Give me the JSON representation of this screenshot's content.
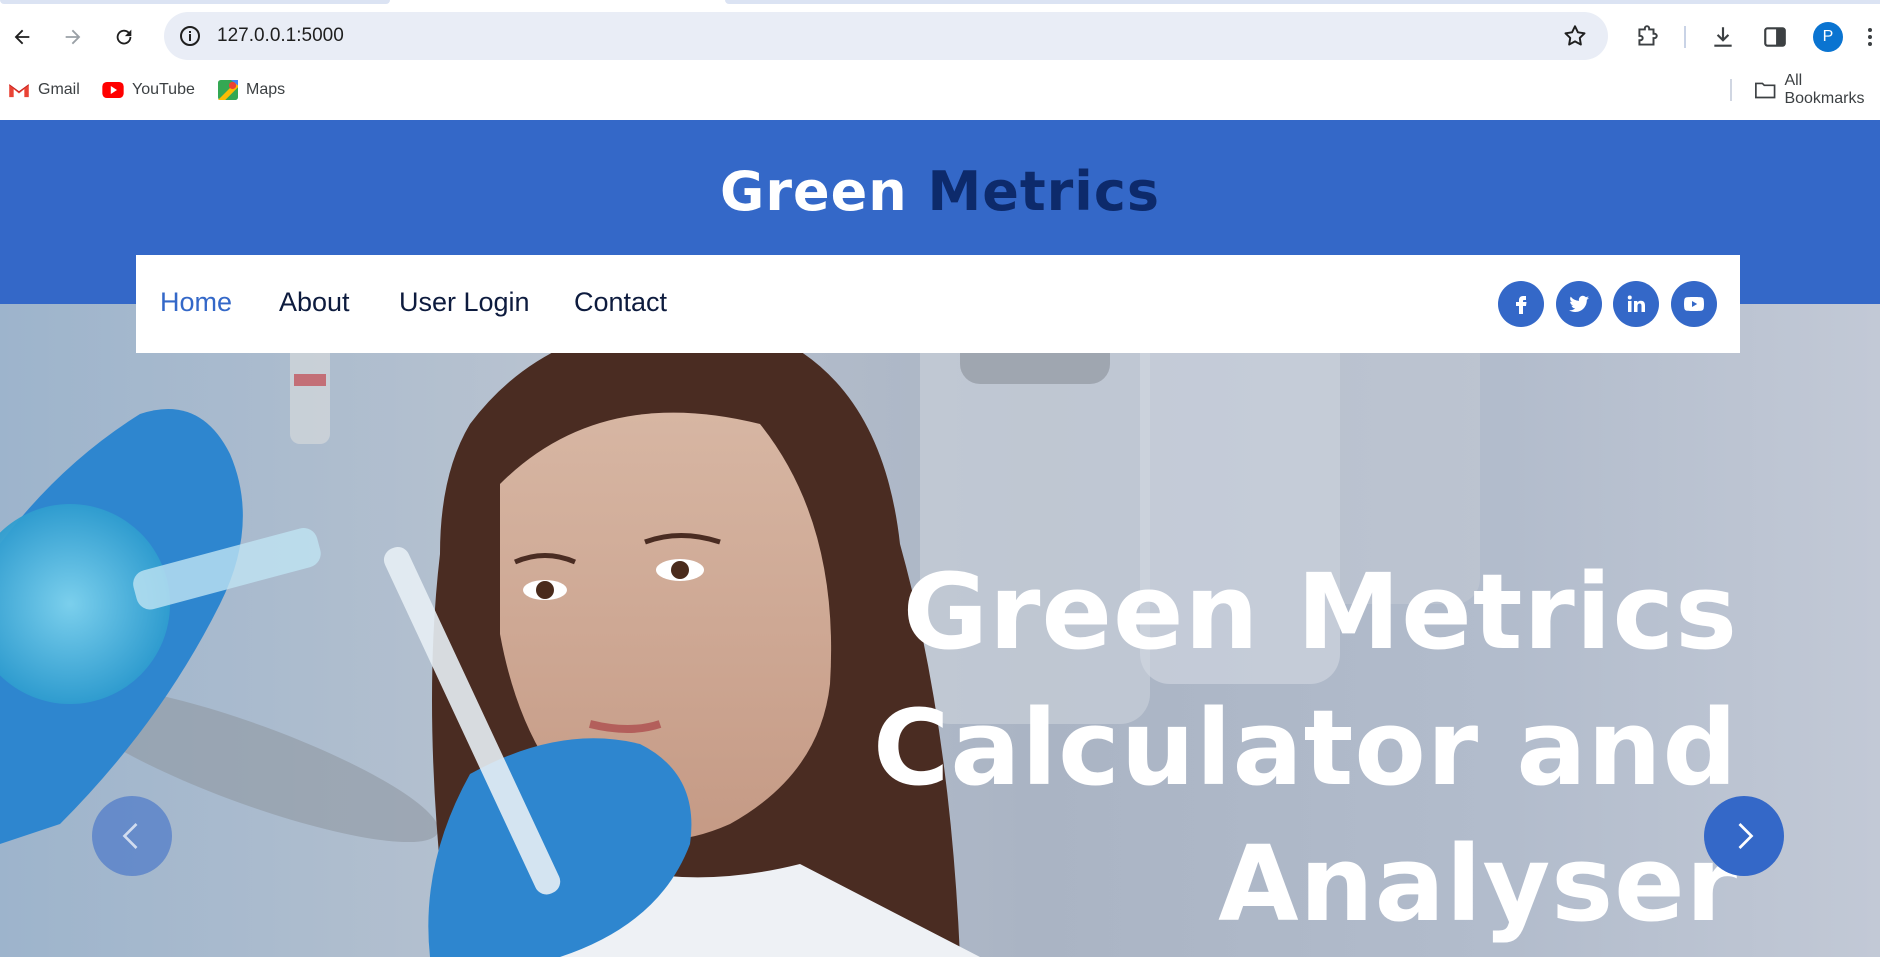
{
  "browser": {
    "url": "127.0.0.1:5000",
    "profile_initial": "P",
    "bookmarks": [
      {
        "label": "Gmail",
        "icon": "gmail-icon"
      },
      {
        "label": "YouTube",
        "icon": "youtube-icon"
      },
      {
        "label": "Maps",
        "icon": "maps-icon"
      }
    ],
    "all_bookmarks_label": "All Bookmarks"
  },
  "site": {
    "title_word1": "Green",
    "title_word2": "Metrics",
    "nav": {
      "home": "Home",
      "about": "About",
      "login": "User Login",
      "contact": "Contact"
    },
    "social": [
      "facebook-icon",
      "twitter-icon",
      "linkedin-icon",
      "youtube-icon"
    ],
    "hero": {
      "line1": "Green Metrics",
      "line2": "Calculator and",
      "line3": "Analyser"
    }
  },
  "colors": {
    "brand_blue": "#3468c8",
    "title_dark": "#0d2a6b",
    "nav_text": "#0d1b3e"
  }
}
